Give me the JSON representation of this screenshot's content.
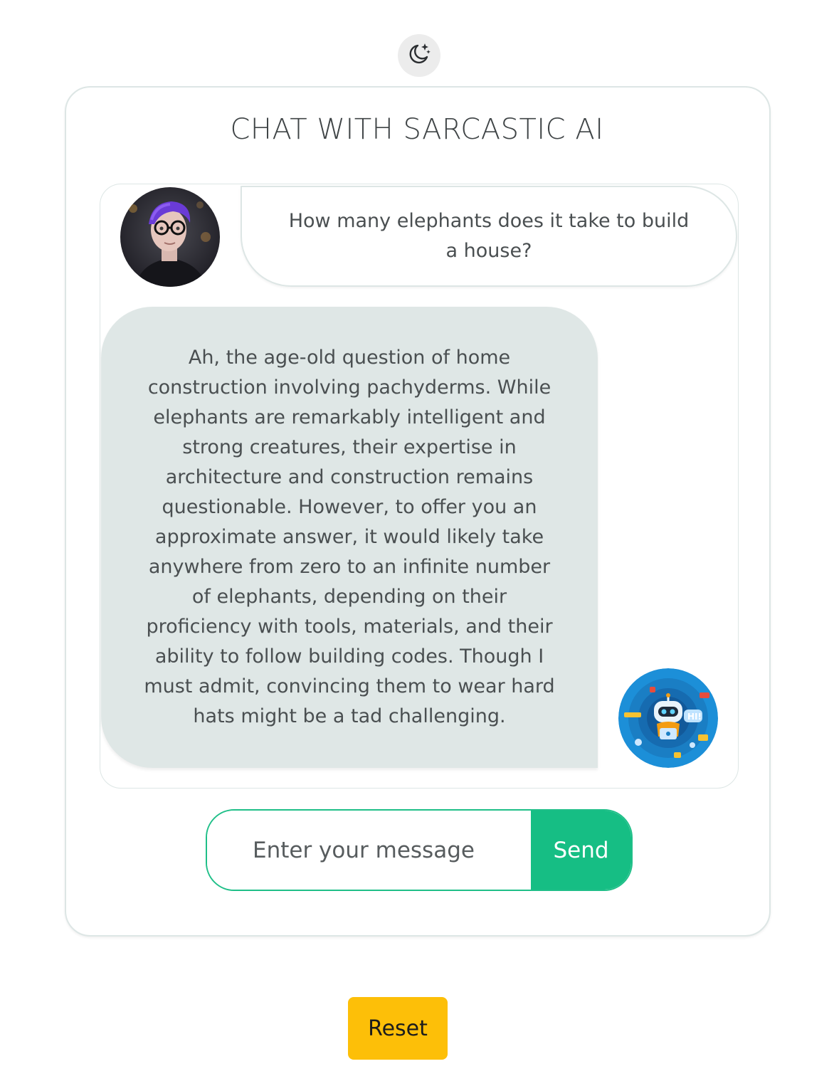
{
  "theme_toggle": {
    "icon": "moon-stars-icon"
  },
  "chat": {
    "title": "CHAT WITH SARCASTIC AI",
    "messages": [
      {
        "role": "user",
        "avatar": "user-avatar",
        "text": "How many elephants does it take to build a house?"
      },
      {
        "role": "bot",
        "avatar": "robot-avatar",
        "text": "Ah, the age-old question of home construction involving pachyderms. While elephants are remarkably intelligent and strong creatures, their expertise in architecture and construction remains questionable. However, to offer you an approximate answer, it would likely take anywhere from zero to an infinite number of elephants, depending on their proficiency with tools, materials, and their ability to follow building codes. Though I must admit, convincing them to wear hard hats might be a tad challenging."
      }
    ]
  },
  "composer": {
    "placeholder": "Enter your message",
    "value": "",
    "send_label": "Send"
  },
  "reset_label": "Reset",
  "colors": {
    "accent": "#16be84",
    "bot_bubble": "#dfe7e6",
    "reset": "#fdbf08",
    "border": "#dde6e5"
  }
}
